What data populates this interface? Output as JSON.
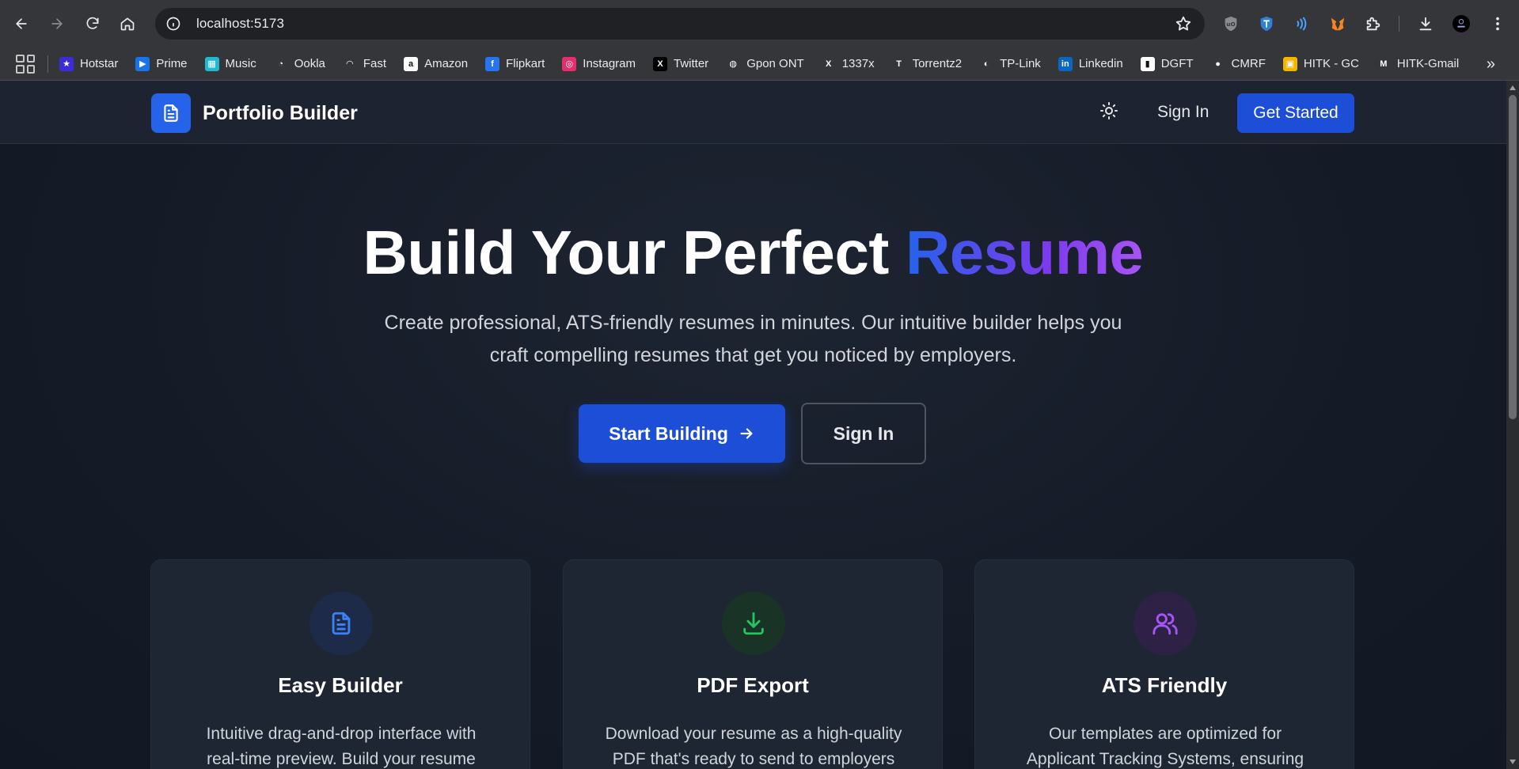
{
  "browser": {
    "url": "localhost:5173",
    "bookmarks": [
      {
        "label": "Hotstar",
        "color": "#3b2bd8",
        "glyph": "★"
      },
      {
        "label": "Prime",
        "color": "#1a73e8",
        "glyph": "▶"
      },
      {
        "label": "Music",
        "color": "#22b8cf",
        "glyph": "▦"
      },
      {
        "label": "Ookla",
        "color": "#35363a",
        "glyph": "◔"
      },
      {
        "label": "Fast",
        "color": "#35363a",
        "glyph": "◠"
      },
      {
        "label": "Amazon",
        "color": "#ffffff",
        "glyph": "a"
      },
      {
        "label": "Flipkart",
        "color": "#2874f0",
        "glyph": "f"
      },
      {
        "label": "Instagram",
        "color": "#e1306c",
        "glyph": "◎"
      },
      {
        "label": "Twitter",
        "color": "#000000",
        "glyph": "X"
      },
      {
        "label": "Gpon ONT",
        "color": "#35363a",
        "glyph": "◍"
      },
      {
        "label": "1337x",
        "color": "#35363a",
        "glyph": "X"
      },
      {
        "label": "Torrentz2",
        "color": "#35363a",
        "glyph": "T"
      },
      {
        "label": "TP-Link",
        "color": "#35363a",
        "glyph": "◐"
      },
      {
        "label": "Linkedin",
        "color": "#0a66c2",
        "glyph": "in"
      },
      {
        "label": "DGFT",
        "color": "#ffffff",
        "glyph": "▮"
      },
      {
        "label": "CMRF",
        "color": "#35363a",
        "glyph": "●"
      },
      {
        "label": "HITK - GC",
        "color": "#f4b400",
        "glyph": "▣"
      },
      {
        "label": "HITK-Gmail",
        "color": "#35363a",
        "glyph": "M"
      }
    ]
  },
  "header": {
    "brand": "Portfolio Builder",
    "sign_in": "Sign In",
    "get_started": "Get Started"
  },
  "hero": {
    "title_main": "Build Your Perfect ",
    "title_accent": "Resume",
    "subtitle": "Create professional, ATS-friendly resumes in minutes. Our intuitive builder helps you craft compelling resumes that get you noticed by employers.",
    "primary_cta": "Start Building",
    "secondary_cta": "Sign In"
  },
  "features": [
    {
      "title": "Easy Builder",
      "description": "Intuitive drag-and-drop interface with real-time preview. Build your resume",
      "icon": "document-icon",
      "icon_color": "#3b82f6",
      "icon_bg": "#1e2b48"
    },
    {
      "title": "PDF Export",
      "description": "Download your resume as a high-quality PDF that's ready to send to employers or",
      "icon": "download-icon",
      "icon_color": "#22c55e",
      "icon_bg": "#1a3327"
    },
    {
      "title": "ATS Friendly",
      "description": "Our templates are optimized for Applicant Tracking Systems, ensuring your resume",
      "icon": "users-icon",
      "icon_color": "#a855f7",
      "icon_bg": "#2d2245"
    }
  ]
}
